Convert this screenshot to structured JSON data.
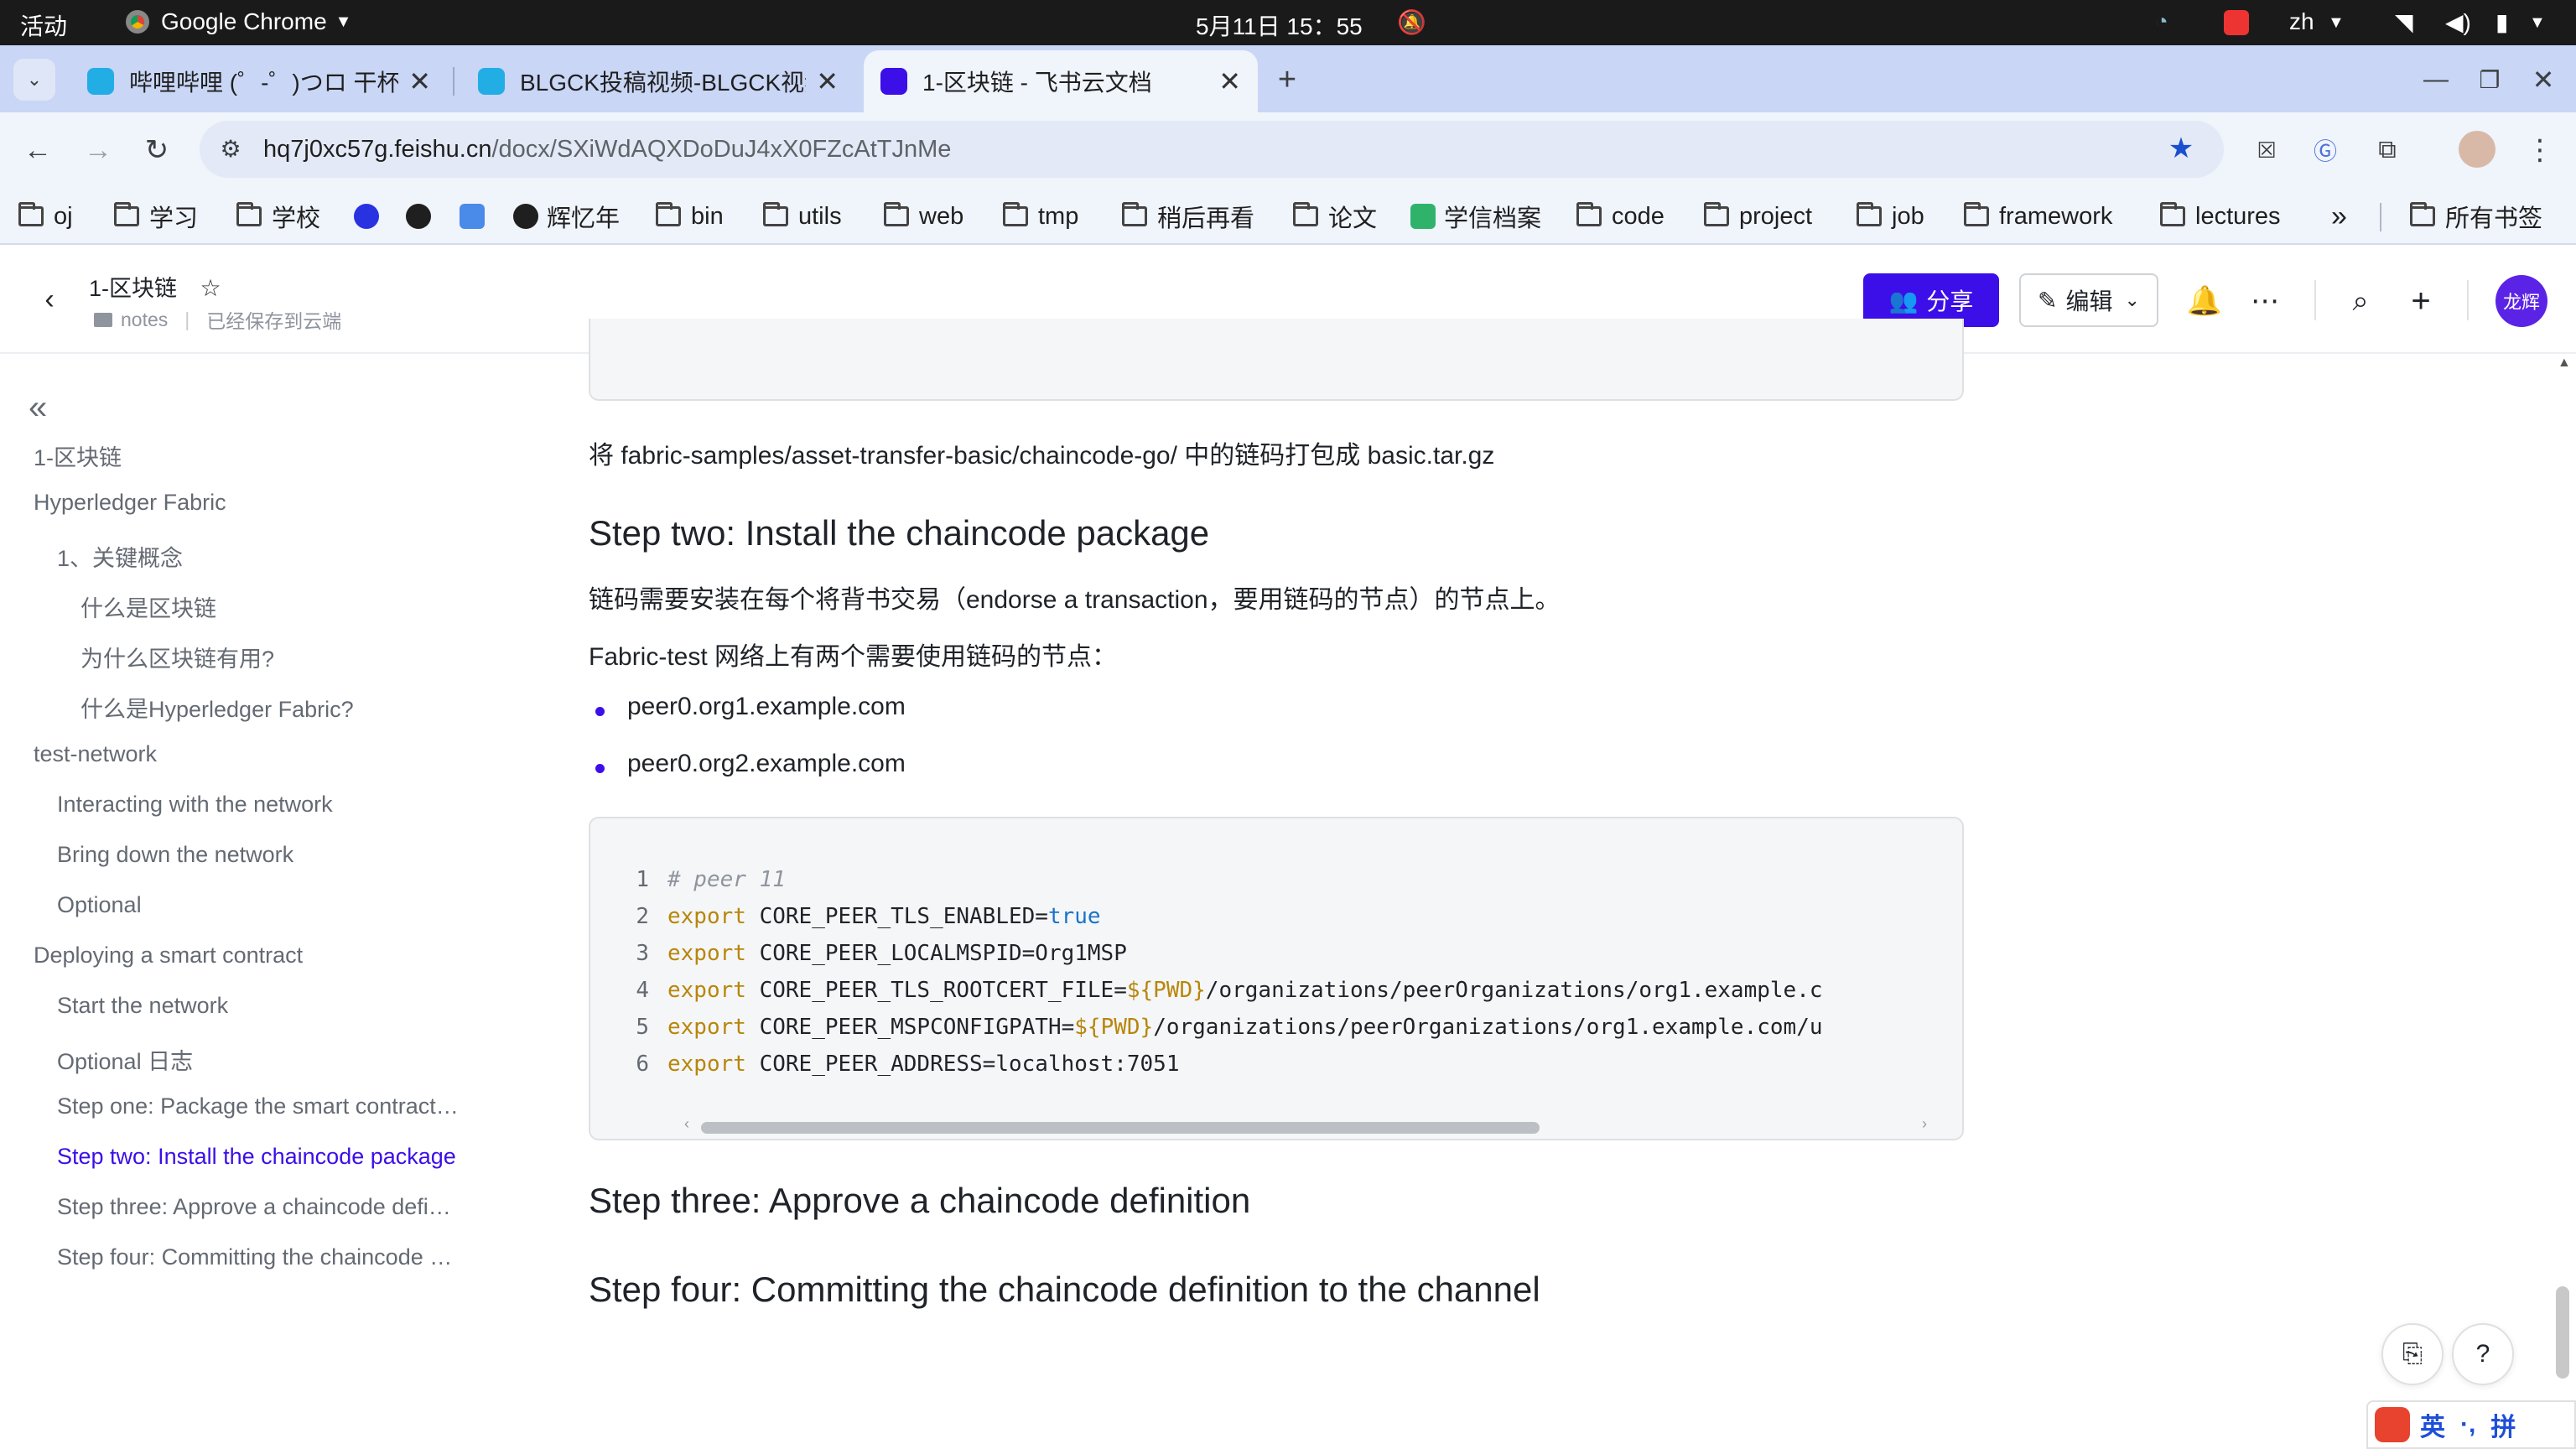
{
  "gnome_bar": {
    "activities": "活动",
    "app_name": "Google Chrome",
    "datetime": "5月11日  15：55",
    "lang": "zh"
  },
  "tabs": [
    {
      "title": "哔哩哔哩 (゜-゜)つロ 干杯~",
      "active": false
    },
    {
      "title": "BLGCK投稿视频-BLGCK视频",
      "active": false
    },
    {
      "title": "1-区块链 - 飞书云文档",
      "active": true
    }
  ],
  "address_bar": {
    "domain": "hq7j0xc57g.feishu.cn",
    "path": "/docx/SXiWdAQXDoDuJ4xX0FZcAtTJnMe"
  },
  "bookmarks": [
    {
      "label": "oj",
      "type": "folder"
    },
    {
      "label": "学习",
      "type": "folder"
    },
    {
      "label": "学校",
      "type": "folder"
    },
    {
      "label": "",
      "type": "baidu"
    },
    {
      "label": "",
      "type": "github"
    },
    {
      "label": "",
      "type": "translate"
    },
    {
      "label": "辉忆年",
      "type": "notion"
    },
    {
      "label": "bin",
      "type": "folder"
    },
    {
      "label": "utils",
      "type": "folder"
    },
    {
      "label": "web",
      "type": "folder"
    },
    {
      "label": "tmp",
      "type": "folder"
    },
    {
      "label": "稍后再看",
      "type": "folder"
    },
    {
      "label": "论文",
      "type": "folder"
    },
    {
      "label": "学信档案",
      "type": "site"
    },
    {
      "label": "code",
      "type": "folder"
    },
    {
      "label": "project",
      "type": "folder"
    },
    {
      "label": "job",
      "type": "folder"
    },
    {
      "label": "framework",
      "type": "folder"
    },
    {
      "label": "lectures",
      "type": "folder"
    }
  ],
  "bookmarks_overflow": "»",
  "all_bookmarks": "所有书签",
  "doc_header": {
    "title": "1-区块链",
    "folder": "notes",
    "save_status": "已经保存到云端",
    "share_label": "分享",
    "edit_label": "编辑",
    "avatar_text": "龙辉"
  },
  "outline": [
    {
      "text": "1-区块链",
      "level": 0,
      "active": false
    },
    {
      "text": "Hyperledger Fabric",
      "level": 0,
      "active": false
    },
    {
      "text": "1、关键概念",
      "level": 1,
      "active": false
    },
    {
      "text": "什么是区块链",
      "level": 2,
      "active": false
    },
    {
      "text": "为什么区块链有用?",
      "level": 2,
      "active": false
    },
    {
      "text": "什么是Hyperledger Fabric?",
      "level": 2,
      "active": false
    },
    {
      "text": "test-network",
      "level": 0,
      "active": false
    },
    {
      "text": "Interacting with the network",
      "level": 1,
      "active": false
    },
    {
      "text": "Bring down the network",
      "level": 1,
      "active": false
    },
    {
      "text": "Optional",
      "level": 1,
      "active": false
    },
    {
      "text": "Deploying a smart contract",
      "level": 0,
      "active": false
    },
    {
      "text": "Start the network",
      "level": 1,
      "active": false
    },
    {
      "text": "Optional 日志",
      "level": 1,
      "active": false
    },
    {
      "text": "Step one: Package the smart contract…",
      "level": 1,
      "active": false
    },
    {
      "text": "Step two: Install the chaincode package",
      "level": 1,
      "active": true
    },
    {
      "text": "Step three: Approve a chaincode defi…",
      "level": 1,
      "active": false
    },
    {
      "text": "Step four: Committing the chaincode …",
      "level": 1,
      "active": false
    }
  ],
  "content": {
    "package_para": "将 fabric-samples/asset-transfer-basic/chaincode-go/ 中的链码打包成 basic.tar.gz",
    "step_two_heading": "Step two: Install the chaincode package",
    "install_para": "链码需要安装在每个将背书交易（endorse a transaction，要用链码的节点）的节点上。",
    "nodes_para": "Fabric-test 网络上有两个需要使用链码的节点：",
    "bullets": [
      "peer0.org1.example.com",
      "peer0.org2.example.com"
    ],
    "code_lines": [
      {
        "n": "1",
        "parts": [
          {
            "t": "# peer 11",
            "c": "cm"
          }
        ]
      },
      {
        "n": "2",
        "parts": [
          {
            "t": "export",
            "c": "kw"
          },
          {
            "t": " CORE_PEER_TLS_ENABLED=",
            "c": ""
          },
          {
            "t": "true",
            "c": "bool"
          }
        ]
      },
      {
        "n": "3",
        "parts": [
          {
            "t": "export",
            "c": "kw"
          },
          {
            "t": " CORE_PEER_LOCALMSPID=Org1MSP",
            "c": ""
          }
        ]
      },
      {
        "n": "4",
        "parts": [
          {
            "t": "export",
            "c": "kw"
          },
          {
            "t": " CORE_PEER_TLS_ROOTCERT_FILE=",
            "c": ""
          },
          {
            "t": "${PWD}",
            "c": "var"
          },
          {
            "t": "/organizations/peerOrganizations/org1.example.c",
            "c": ""
          }
        ]
      },
      {
        "n": "5",
        "parts": [
          {
            "t": "export",
            "c": "kw"
          },
          {
            "t": " CORE_PEER_MSPCONFIGPATH=",
            "c": ""
          },
          {
            "t": "${PWD}",
            "c": "var"
          },
          {
            "t": "/organizations/peerOrganizations/org1.example.com/u",
            "c": ""
          }
        ]
      },
      {
        "n": "6",
        "parts": [
          {
            "t": "export",
            "c": "kw"
          },
          {
            "t": " CORE_PEER_ADDRESS=localhost:7051",
            "c": ""
          }
        ]
      }
    ],
    "step_three_heading": "Step three: Approve a chaincode definition",
    "step_four_heading": "Step four: Committing the chaincode definition to the channel"
  },
  "ime": {
    "lang": "英",
    "punct": "·,",
    "mode": "拼"
  },
  "colors": {
    "accent": "#3c0ee8",
    "tab_strip": "#c9d6f5",
    "toolbar": "#f0f4fb"
  }
}
